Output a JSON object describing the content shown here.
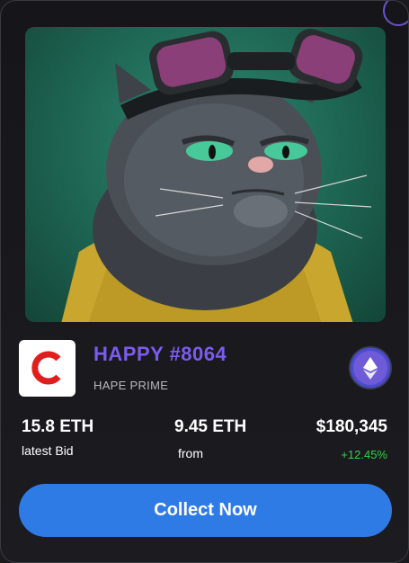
{
  "nft": {
    "title": "HAPPY #8064",
    "collection": "HAPE PRIME",
    "image_icon": "grumpy-cat-with-goggles-illustration"
  },
  "brand": {
    "icon": "brand-c-logo-icon",
    "color": "#e01e1e"
  },
  "currency": {
    "icon": "ethereum-icon",
    "color": "#6f5ad8"
  },
  "stats": {
    "latest_bid": {
      "value": "15.8 ETH",
      "label": "latest Bid"
    },
    "floor": {
      "value": "9.45 ETH",
      "label": "from"
    },
    "usd": {
      "value": "$180,345",
      "change": "+12.45%"
    }
  },
  "actions": {
    "collect_label": "Collect Now",
    "accent": "#2f7be6"
  },
  "colors": {
    "title": "#7b5cf0",
    "positive": "#35d04a",
    "background": "#16161a"
  }
}
